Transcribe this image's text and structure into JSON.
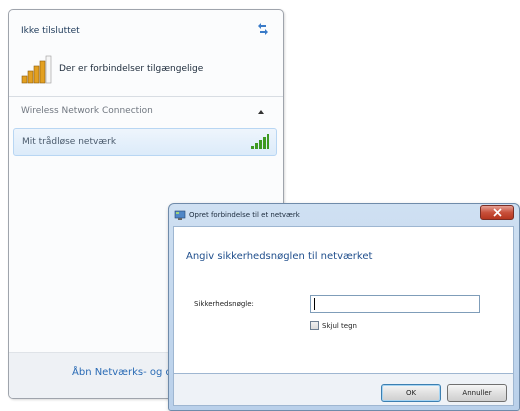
{
  "flyout": {
    "status_title": "Ikke tilsluttet",
    "availability_text": "Der er forbindelser tilgængelige",
    "section_label": "Wireless Network Connection",
    "network_name": "Mit trådløse netværk",
    "footer_link": "Åbn Netværks- og d"
  },
  "dialog": {
    "title": "Opret forbindelse til et netværk",
    "heading": "Angiv sikkerhedsnøglen til netværket",
    "key_label": "Sikkerhedsnøgle:",
    "key_value": "",
    "hide_chars_label": "Skjul tegn",
    "hide_chars_checked": false,
    "ok_label": "OK",
    "cancel_label": "Annuller"
  },
  "icons": {
    "refresh": "refresh-icon",
    "signal": "signal-strength-icon",
    "collapse": "chevron-up-icon",
    "close": "close-icon",
    "window": "network-window-icon"
  },
  "colors": {
    "link": "#2a6bb5",
    "heading": "#1f4e8c",
    "close_button": "#c8503b",
    "signal_green": "#3f9a22"
  }
}
